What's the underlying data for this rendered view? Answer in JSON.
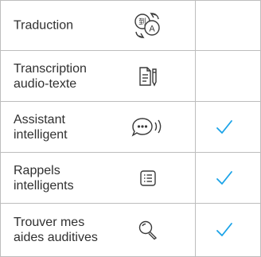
{
  "features": [
    {
      "label": "Traduction",
      "icon": "translate-icon",
      "supported": false
    },
    {
      "label": "Transcription\naudio-texte",
      "icon": "transcription-icon",
      "supported": false
    },
    {
      "label": "Assistant\nintelligent",
      "icon": "chat-bubble-icon",
      "supported": true
    },
    {
      "label": "Rappels\nintelligents",
      "icon": "reminder-list-icon",
      "supported": true
    },
    {
      "label": "Trouver mes\naides auditives",
      "icon": "magnifier-icon",
      "supported": true
    }
  ],
  "colors": {
    "check": "#1aa3e8",
    "border": "#bdbdbd",
    "text": "#303030",
    "icon": "#3a3a3a"
  }
}
